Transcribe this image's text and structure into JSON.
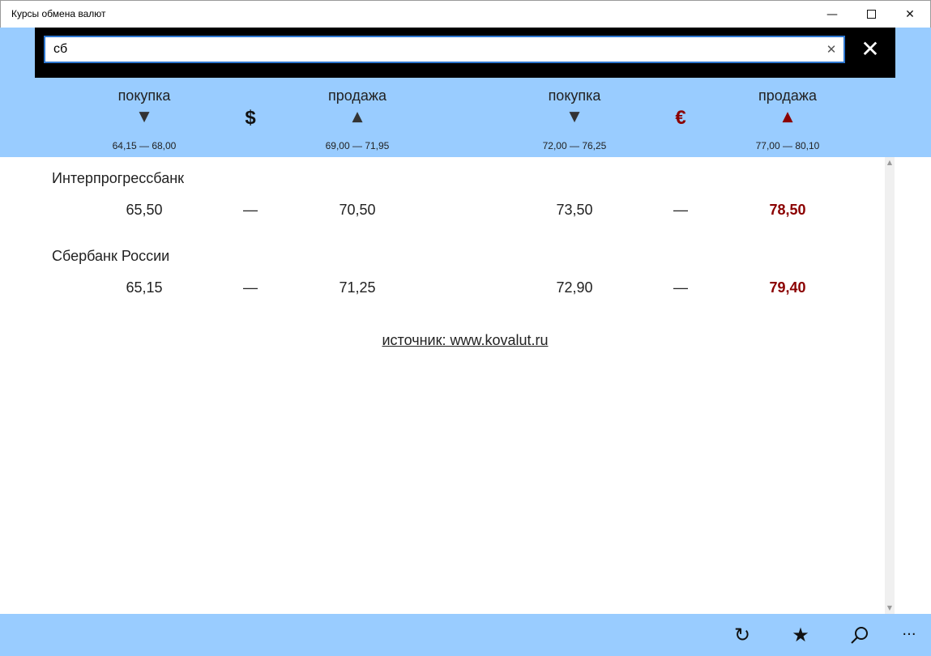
{
  "window": {
    "title": "Курсы обмена валют",
    "minimize_glyph": "—",
    "close_glyph": "✕"
  },
  "search": {
    "value": "сб",
    "clear_glyph": "✕",
    "close_glyph": "✕"
  },
  "columns": {
    "usd_buy": {
      "label": "покупка",
      "arrow": "▼",
      "range": "64,15 — 68,00"
    },
    "usd_symbol": "$",
    "usd_sell": {
      "label": "продажа",
      "arrow": "▲",
      "range": "69,00 — 71,95"
    },
    "eur_buy": {
      "label": "покупка",
      "arrow": "▼",
      "range": "72,00 — 76,25"
    },
    "eur_symbol": "€",
    "eur_sell": {
      "label": "продажа",
      "arrow": "▲",
      "range": "77,00 — 80,10"
    }
  },
  "colors": {
    "header_bg": "#99ccff",
    "accent_red": "#8b0000",
    "search_border": "#2e77d0"
  },
  "banks": [
    {
      "name": "Интерпрогрессбанк",
      "usd_buy": "65,50",
      "usd_sep": "—",
      "usd_sell": "70,50",
      "eur_buy": "73,50",
      "eur_sep": "—",
      "eur_sell": "78,50"
    },
    {
      "name": "Сбербанк России",
      "usd_buy": "65,15",
      "usd_sep": "—",
      "usd_sell": "71,25",
      "eur_buy": "72,90",
      "eur_sep": "—",
      "eur_sell": "79,40"
    }
  ],
  "source_link": "источник: www.kovalut.ru",
  "appbar": {
    "refresh_icon": "refresh-icon",
    "refresh_glyph": "↻",
    "favorite_icon": "star-icon",
    "favorite_glyph": "★",
    "search_icon": "search-icon",
    "more_icon": "more-icon",
    "more_glyph": "···"
  }
}
